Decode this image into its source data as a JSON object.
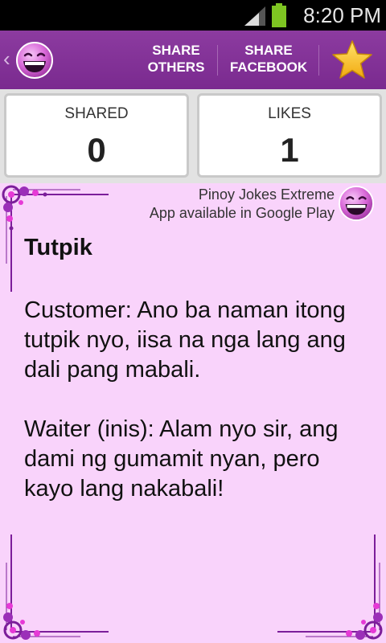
{
  "status_bar": {
    "time": "8:20 PM",
    "signal_icon": "signal-icon",
    "battery_icon": "battery-icon",
    "battery_color": "#7ec522"
  },
  "action_bar": {
    "back_glyph": "‹",
    "logo_icon": "laughing-face-icon",
    "share_others_line1": "SHARE",
    "share_others_line2": "OTHERS",
    "share_facebook_line1": "SHARE",
    "share_facebook_line2": "FACEBOOK",
    "favorite_icon": "star-icon",
    "bar_color": "#803495",
    "star_color": "#f6c51d"
  },
  "stats": {
    "shared_label": "SHARED",
    "shared_value": "0",
    "likes_label": "LIKES",
    "likes_value": "1"
  },
  "promo": {
    "line1": "Pinoy Jokes Extreme",
    "line2": "App available in Google Play",
    "logo_icon": "laughing-face-icon"
  },
  "joke": {
    "title": "Tutpik",
    "paragraphs": [
      "Customer: Ano ba naman itong tutpik nyo, iisa na nga lang ang dali pang mabali.",
      "Waiter (inis): Alam nyo sir, ang dami ng gumamit nyan, pero kayo lang nakabali!"
    ],
    "background_color": "#f9d3fb"
  }
}
